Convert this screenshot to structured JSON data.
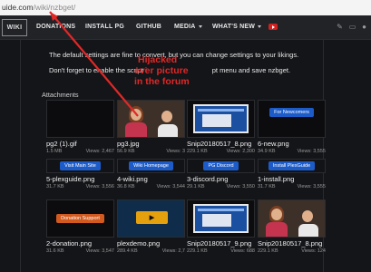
{
  "browser": {
    "url_host": "uide.com",
    "url_path": "/wiki/nzbget/"
  },
  "navbar": {
    "logo": "WIKI",
    "items": [
      "DONATIONS",
      "INSTALL PG",
      "GITHUB",
      "MEDIA",
      "WHAT'S NEW"
    ],
    "youtube_icon": "youtube-icon",
    "tool_icons": [
      "wrench-icon",
      "monitor-icon",
      "user-icon"
    ]
  },
  "content": {
    "line1": "The default settings are fine to convert, but you can change settings to your likings.",
    "line2_a": "Don't forget to enable the script i",
    "line2_b": "pt menu and save nzbget.",
    "attachments_title": "Attachments"
  },
  "annotation": {
    "line1": "Hijacked",
    "line2": "ever picture",
    "line3": "in the forum",
    "color": "#e02828"
  },
  "attachments": [
    {
      "name": "pg2 (1).gif",
      "size": "1.5 MB",
      "views": "Views: 2,467",
      "kind": "dark"
    },
    {
      "name": "pg3.jpg",
      "size": "56.9 KB",
      "views": "Views: 3",
      "kind": "photo"
    },
    {
      "name": "Snip20180517_8.png",
      "size": "229.1 KB",
      "views": "Views: 2,300",
      "kind": "screen"
    },
    {
      "name": "6-new.png",
      "size": "34.9 KB",
      "views": "Views: 3,555",
      "kind": "banner",
      "label": "For Newcomers"
    },
    {
      "name": "5-plexguide.png",
      "size": "31.7 KB",
      "views": "Views: 3,556",
      "kind": "banner",
      "label": "Visit Main Site"
    },
    {
      "name": "4-wiki.png",
      "size": "36.8 KB",
      "views": "Views: 3,544",
      "kind": "banner",
      "label": "Wiki Homepage"
    },
    {
      "name": "3-discord.png",
      "size": "29.1 KB",
      "views": "Views: 3,550",
      "kind": "banner",
      "label": "PG Discord"
    },
    {
      "name": "1-install.png",
      "size": "31.7 KB",
      "views": "Views: 3,555",
      "kind": "banner",
      "label": "Install PlexGuide"
    },
    {
      "name": "2-donation.png",
      "size": "31.6 KB",
      "views": "Views: 3,547",
      "kind": "banner-red",
      "label": "Donation Support"
    },
    {
      "name": "plexdemo.png",
      "size": "289.4 KB",
      "views": "Views: 2,7",
      "kind": "plex"
    },
    {
      "name": "Snip20180517_9.png",
      "size": "229.1 KB",
      "views": "Views: 688",
      "kind": "screen"
    },
    {
      "name": "Snip20180517_8.png",
      "size": "229.1 KB",
      "views": "Views: 124",
      "kind": "photo"
    }
  ],
  "colors": {
    "background": "#141518",
    "navbar": "#222327",
    "banner_blue": "#1d5cc8",
    "banner_red": "#d25a1f",
    "arrow": "#e02828"
  }
}
